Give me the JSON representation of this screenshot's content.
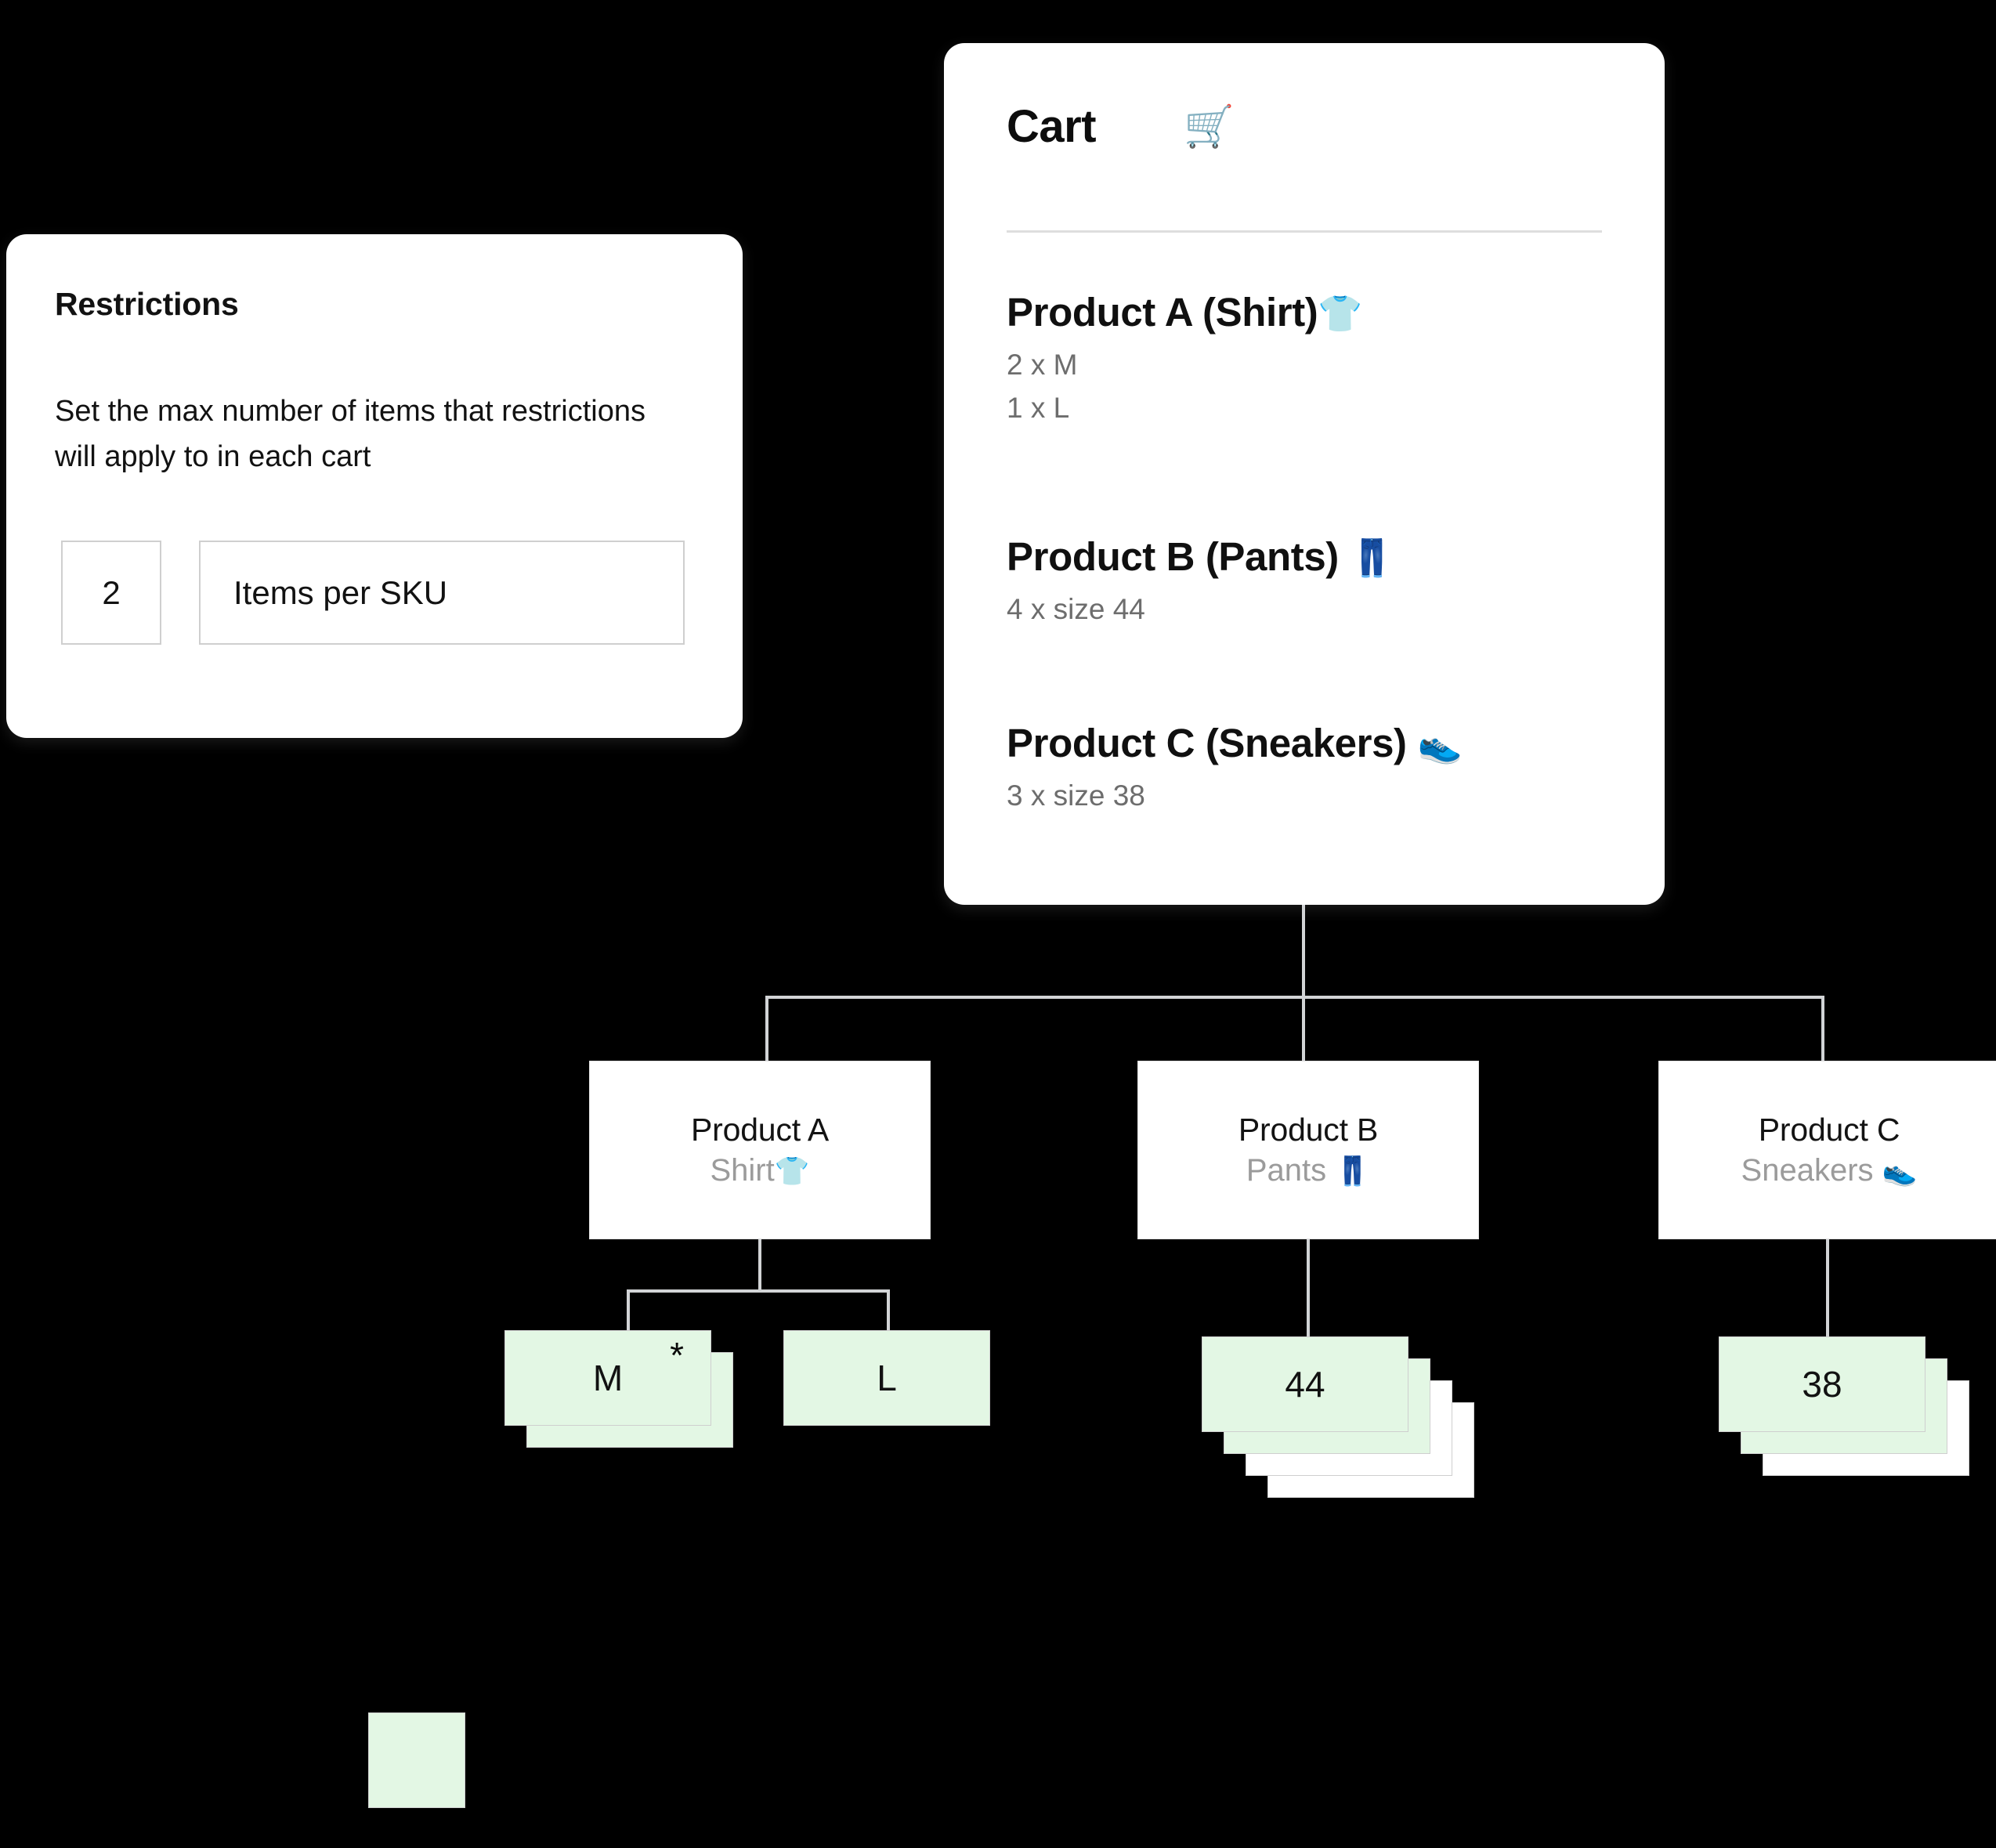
{
  "restrictions_card": {
    "title": "Restrictions",
    "description": "Set the max number of items  that restrictions will apply to in each cart",
    "quantity_value": "2",
    "quantity_placeholder": "2",
    "unit_label": "Items per SKU",
    "unit_placeholder": "Items per SKU"
  },
  "cart_card": {
    "title": "Cart",
    "icon": "shopping-cart",
    "icon_glyph": "🛒",
    "items": [
      {
        "name": "Product A (Shirt)",
        "emoji": "👕",
        "emoji_name": "shirt-emoji",
        "lines": [
          "2 x M",
          "1 x L"
        ]
      },
      {
        "name": "Product B (Pants)",
        "emoji": "👖",
        "emoji_name": "jeans-emoji",
        "lines": [
          "4 x size 44"
        ]
      },
      {
        "name": "Product C (Sneakers)",
        "emoji": "👟",
        "emoji_name": "sneaker-emoji",
        "lines": [
          "3 x  size 38"
        ]
      }
    ]
  },
  "tree": {
    "nodes": [
      {
        "title": "Product A",
        "subtitle": "Shirt",
        "emoji": "👕",
        "emoji_name": "shirt-emoji",
        "variants": [
          {
            "label": "M",
            "total": 2,
            "allowed": 2,
            "starred": true
          },
          {
            "label": "L",
            "total": 1,
            "allowed": 1,
            "starred": false
          }
        ]
      },
      {
        "title": "Product B",
        "subtitle": "Pants",
        "emoji": "👖",
        "emoji_name": "jeans-emoji",
        "variants": [
          {
            "label": "44",
            "total": 4,
            "allowed": 2,
            "starred": false
          }
        ]
      },
      {
        "title": "Product C",
        "subtitle": "Sneakers",
        "emoji": "👟",
        "emoji_name": "sneaker-emoji",
        "variants": [
          {
            "label": "38",
            "total": 3,
            "allowed": 2,
            "starred": false
          }
        ]
      }
    ]
  },
  "legend": {
    "swatch_color": "#e3f7e4",
    "label": ""
  },
  "colors": {
    "background": "#000000",
    "card_surface": "#ffffff",
    "allowed_green": "#e3f7e4",
    "connector_gray": "#d2d4d6",
    "muted_text": "#9b9b9b",
    "body_text": "#121212",
    "divider": "#dedede"
  },
  "markers": {
    "asterisk": "*"
  }
}
